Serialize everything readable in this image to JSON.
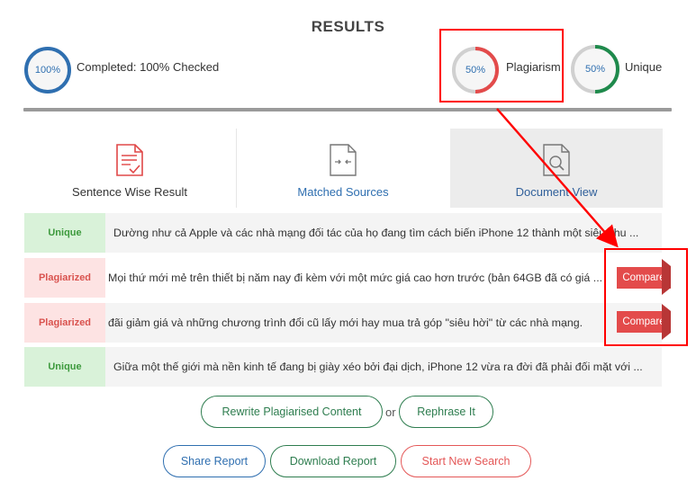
{
  "results": {
    "title": "RESULTS",
    "completed": {
      "percent_text": "100%",
      "label": "Completed: 100% Checked",
      "color": "#2f6fb0"
    },
    "plagiarism": {
      "percent_text": "50%",
      "label": "Plagiarism",
      "color": "#e34b4b",
      "fraction": 0.5
    },
    "unique": {
      "percent_text": "50%",
      "label": "Unique",
      "color": "#1f8a4c",
      "fraction": 0.5
    }
  },
  "tabs": [
    {
      "label": "Sentence Wise Result",
      "icon": "document-check-icon"
    },
    {
      "label": "Matched Sources",
      "icon": "document-arrows-icon"
    },
    {
      "label": "Document View",
      "icon": "document-search-icon"
    }
  ],
  "rows": [
    {
      "status": "Unique",
      "text": "Dường như cả Apple và các nhà mạng đối tác của họ đang tìm cách biến iPhone 12 thành một siêu chu ..."
    },
    {
      "status": "Plagiarized",
      "text": "Mọi thứ mới mẻ trên thiết bị năm nay đi kèm với một mức giá cao hơn trước (bản 64GB đã có giá ...",
      "action": "Compare"
    },
    {
      "status": "Plagiarized",
      "text": "đãi giảm giá và những chương trình đổi cũ lấy mới hay mua trả góp \"siêu hời\" từ các nhà mạng.",
      "action": "Compare"
    },
    {
      "status": "Unique",
      "text": "Giữa một thế giới mà nền kinh tế đang bị giày xéo bởi đại dịch, iPhone 12 vừa ra đời đã phải đối mặt với ..."
    }
  ],
  "actions": {
    "rewrite": "Rewrite Plagiarised Content",
    "or": "or",
    "rephrase": "Rephrase It",
    "share": "Share Report",
    "download": "Download Report",
    "new_search": "Start New Search"
  },
  "colors": {
    "unique_badge_bg": "#d9f2d9",
    "plagiarized_badge_bg": "#fde3e3",
    "compare_bg": "#e34b4b",
    "annotation_red": "#ff0000"
  }
}
